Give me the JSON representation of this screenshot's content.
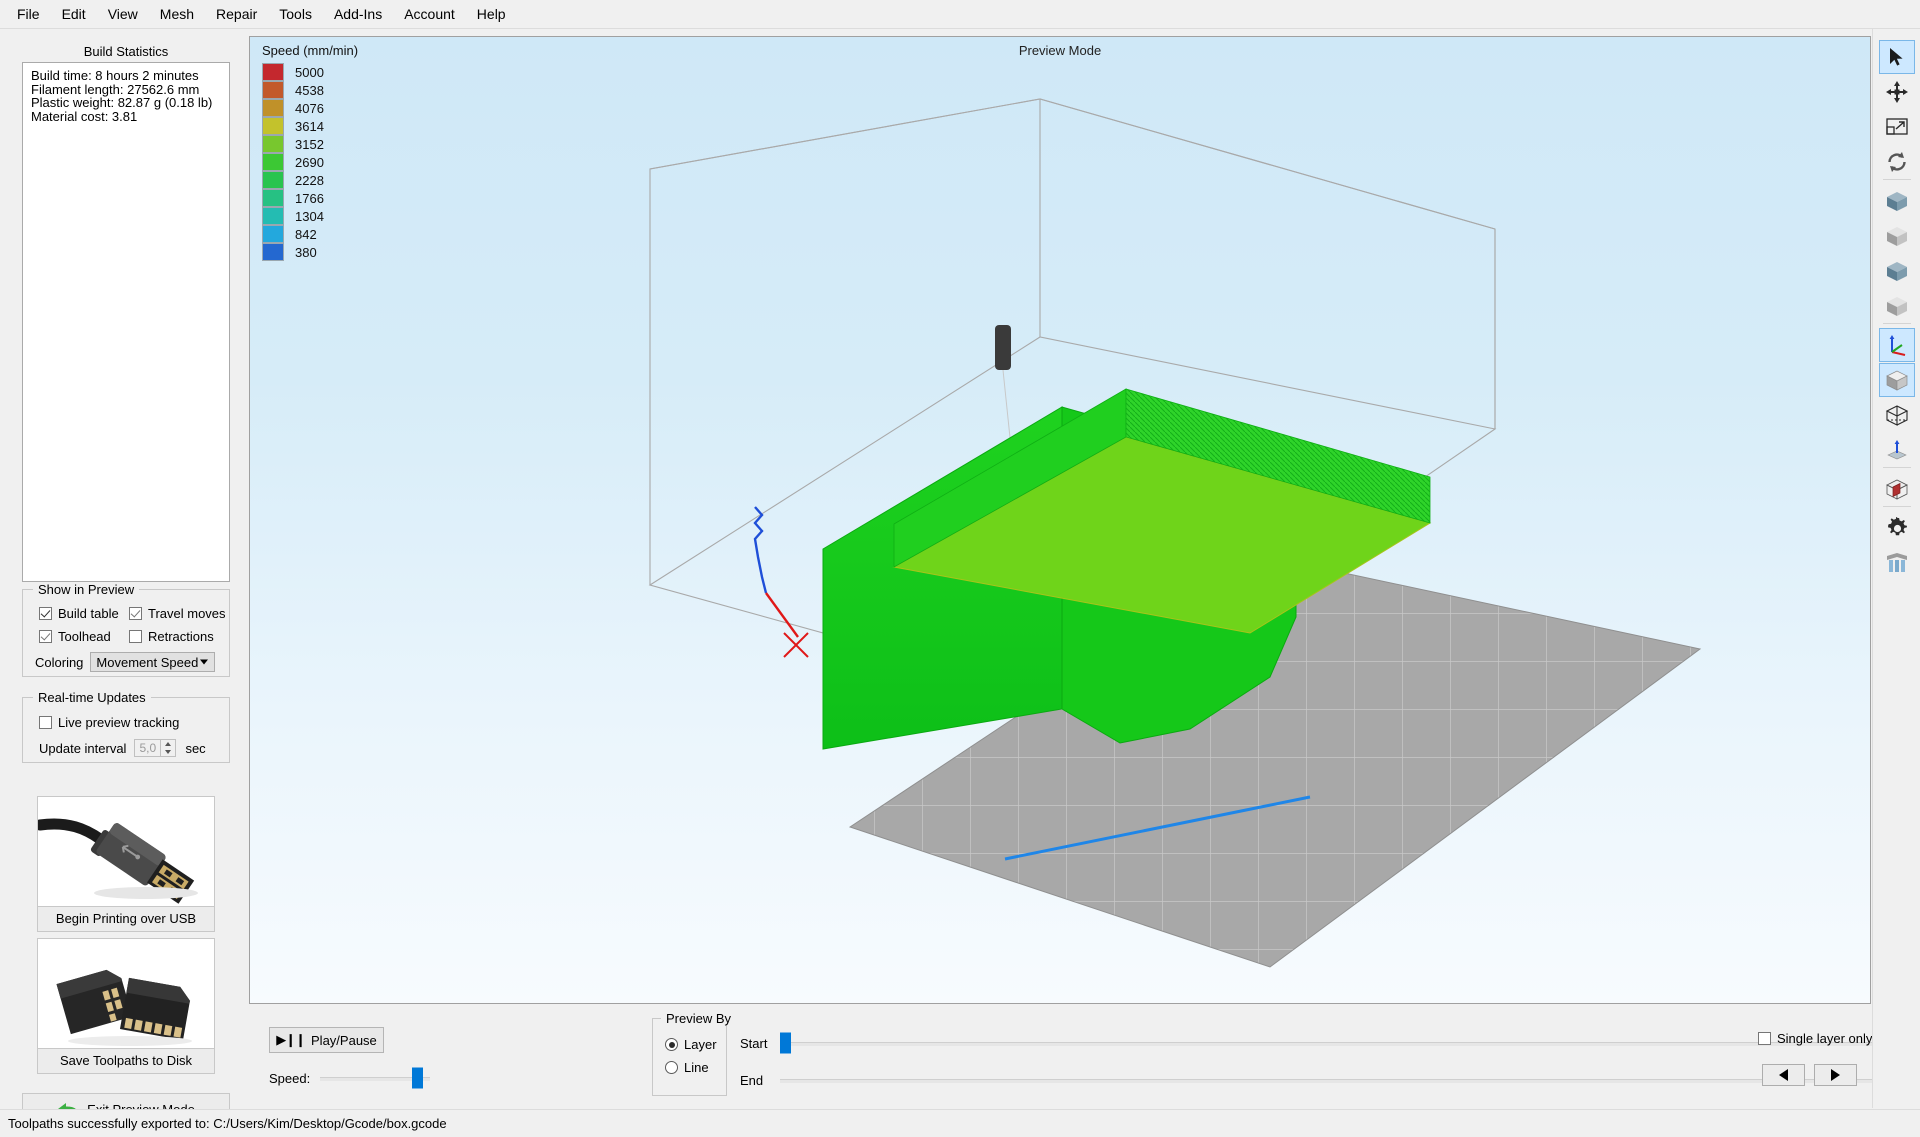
{
  "menu": {
    "items": [
      "File",
      "Edit",
      "View",
      "Mesh",
      "Repair",
      "Tools",
      "Add-Ins",
      "Account",
      "Help"
    ]
  },
  "left_panel": {
    "build_statistics": {
      "title": "Build Statistics",
      "lines": [
        "Build time: 8 hours 2 minutes",
        "Filament length: 27562.6 mm",
        "Plastic weight: 82.87 g (0.18 lb)",
        "Material cost: 3.81"
      ]
    },
    "show_in_preview": {
      "title": "Show in Preview",
      "checkboxes": [
        {
          "label": "Build table",
          "checked": true
        },
        {
          "label": "Travel moves",
          "checked": true
        },
        {
          "label": "Toolhead",
          "checked": true
        },
        {
          "label": "Retractions",
          "checked": false
        }
      ],
      "coloring_label": "Coloring",
      "coloring_value": "Movement Speed"
    },
    "realtime_updates": {
      "title": "Real-time Updates",
      "live_preview_label": "Live preview tracking",
      "live_preview_checked": false,
      "interval_label": "Update interval",
      "interval_value": "5,0",
      "interval_unit": "sec"
    },
    "usb_button_label": "Begin Printing over USB",
    "sd_button_label": "Save Toolpaths to Disk",
    "exit_button_label": "Exit Preview Mode"
  },
  "viewport": {
    "preview_mode_label": "Preview Mode",
    "legend_title": "Speed (mm/min)",
    "legend": [
      {
        "value": "5000",
        "color": "#c4282e"
      },
      {
        "value": "4538",
        "color": "#c2592b"
      },
      {
        "value": "4076",
        "color": "#c09129"
      },
      {
        "value": "3614",
        "color": "#c3c22c"
      },
      {
        "value": "3152",
        "color": "#78c72e"
      },
      {
        "value": "2690",
        "color": "#3cc834"
      },
      {
        "value": "2228",
        "color": "#29c44f"
      },
      {
        "value": "1766",
        "color": "#26c183"
      },
      {
        "value": "1304",
        "color": "#24bcb2"
      },
      {
        "value": "842",
        "color": "#23a8dd"
      },
      {
        "value": "380",
        "color": "#2468d0"
      }
    ]
  },
  "bottom_bar": {
    "play_pause_label": "Play/Pause",
    "speed_label": "Speed:",
    "preview_by": {
      "title": "Preview By",
      "options": [
        {
          "label": "Layer",
          "selected": true
        },
        {
          "label": "Line",
          "selected": false
        }
      ]
    },
    "start_label": "Start",
    "end_label": "End",
    "single_layer_label": "Single layer only",
    "single_layer_checked": false,
    "prev_button": "previous-layer",
    "next_button": "next-layer"
  },
  "right_toolbar": {
    "tools": [
      {
        "name": "select-arrow-tool",
        "selected": true
      },
      {
        "name": "move-tool",
        "selected": false
      },
      {
        "name": "scale-tool",
        "selected": false
      },
      {
        "name": "rotate-tool",
        "selected": false
      },
      {
        "name": "view-front-tool",
        "selected": false
      },
      {
        "name": "view-back-tool",
        "selected": false
      },
      {
        "name": "view-left-tool",
        "selected": false
      },
      {
        "name": "view-right-tool",
        "selected": false
      },
      {
        "name": "view-axes-tool",
        "selected": true
      },
      {
        "name": "view-iso-tool",
        "selected": true
      },
      {
        "name": "view-wireframe-tool",
        "selected": false
      },
      {
        "name": "view-top-tool",
        "selected": false
      },
      {
        "name": "cross-section-tool",
        "selected": false
      },
      {
        "name": "settings-gear-tool",
        "selected": false
      },
      {
        "name": "supports-tool",
        "selected": false
      }
    ]
  },
  "status_bar": {
    "message": "Toolpaths successfully exported to: C:/Users/Kim/Desktop/Gcode/box.gcode"
  }
}
